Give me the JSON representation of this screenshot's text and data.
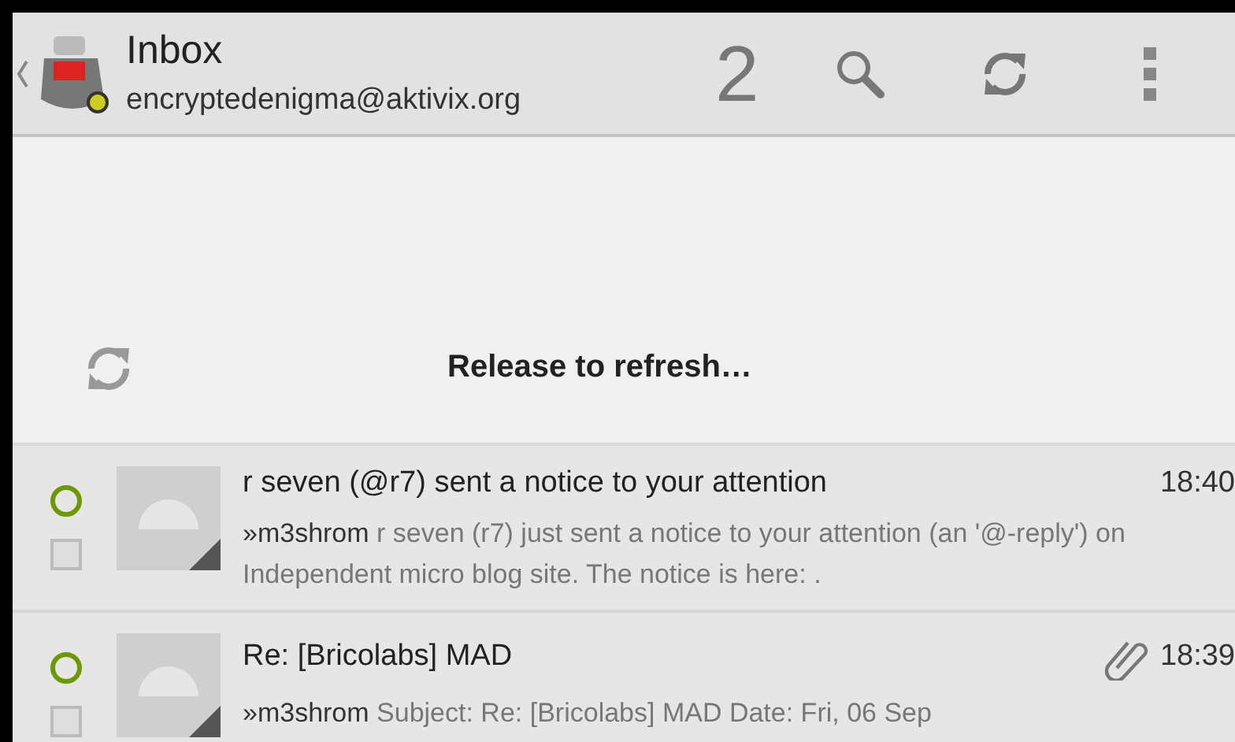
{
  "header": {
    "title": "Inbox",
    "account": "encryptedenigma@aktivix.org",
    "unread_count": "2"
  },
  "pull_refresh": {
    "label": "Release to refresh…"
  },
  "messages": [
    {
      "subject": "r seven (@r7) sent a notice to your attention",
      "time": "18:40",
      "sender": "»m3shrom",
      "preview": "r seven (r7) just sent a notice to your attention (an '@-reply') on Independent micro blog site. The notice is here: .",
      "unread": true,
      "checked": false,
      "attachment": false
    },
    {
      "subject": "Re: [Bricolabs] MAD",
      "time": "18:39",
      "sender": "»m3shrom",
      "preview": "Subject: Re: [Bricolabs] MAD Date: Fri, 06 Sep",
      "unread": true,
      "checked": false,
      "attachment": true
    }
  ]
}
